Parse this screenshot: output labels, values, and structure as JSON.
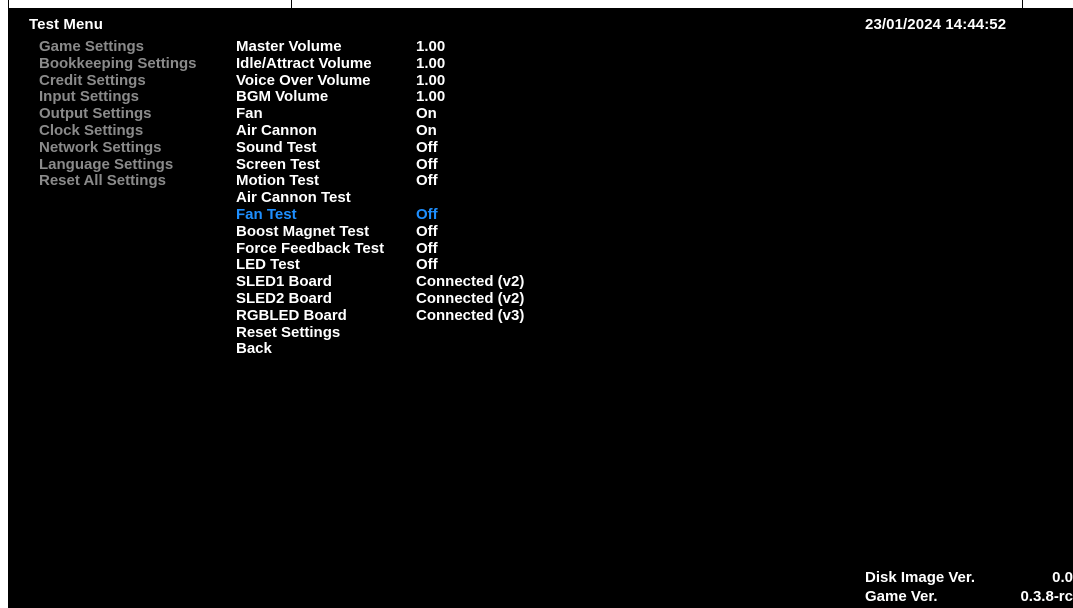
{
  "header": {
    "title": "Test Menu",
    "datetime": "23/01/2024 14:44:52"
  },
  "categories": [
    "Game Settings",
    "Bookkeeping Settings",
    "Credit Settings",
    "Input Settings",
    "Output Settings",
    "Clock Settings",
    "Network Settings",
    "Language Settings",
    "Reset All Settings"
  ],
  "options": [
    {
      "label": "Master Volume",
      "value": "1.00"
    },
    {
      "label": "Idle/Attract Volume",
      "value": "1.00"
    },
    {
      "label": "Voice Over Volume",
      "value": "1.00"
    },
    {
      "label": "BGM Volume",
      "value": "1.00"
    },
    {
      "label": "Fan",
      "value": "On"
    },
    {
      "label": "Air Cannon",
      "value": "On"
    },
    {
      "label": "Sound Test",
      "value": "Off"
    },
    {
      "label": "Screen Test",
      "value": "Off"
    },
    {
      "label": "Motion Test",
      "value": "Off"
    },
    {
      "label": "Air Cannon Test",
      "value": ""
    },
    {
      "label": "Fan Test",
      "value": "Off",
      "selected": true
    },
    {
      "label": "Boost Magnet Test",
      "value": "Off"
    },
    {
      "label": "Force Feedback Test",
      "value": "Off"
    },
    {
      "label": "LED Test",
      "value": "Off"
    },
    {
      "label": "SLED1 Board",
      "value": "Connected (v2)"
    },
    {
      "label": "SLED2 Board",
      "value": "Connected (v2)"
    },
    {
      "label": "RGBLED Board",
      "value": "Connected (v3)"
    },
    {
      "label": "Reset Settings",
      "value": ""
    },
    {
      "label": "Back",
      "value": ""
    }
  ],
  "footer": {
    "disk_image_label": "Disk Image Ver.",
    "disk_image_value": "0.0",
    "game_ver_label": "Game Ver.",
    "game_ver_value": "0.3.8-rc"
  },
  "colors": {
    "background": "#000000",
    "text": "#ffffff",
    "inactive_category": "#8a8a8a",
    "selected": "#1e8fff"
  }
}
